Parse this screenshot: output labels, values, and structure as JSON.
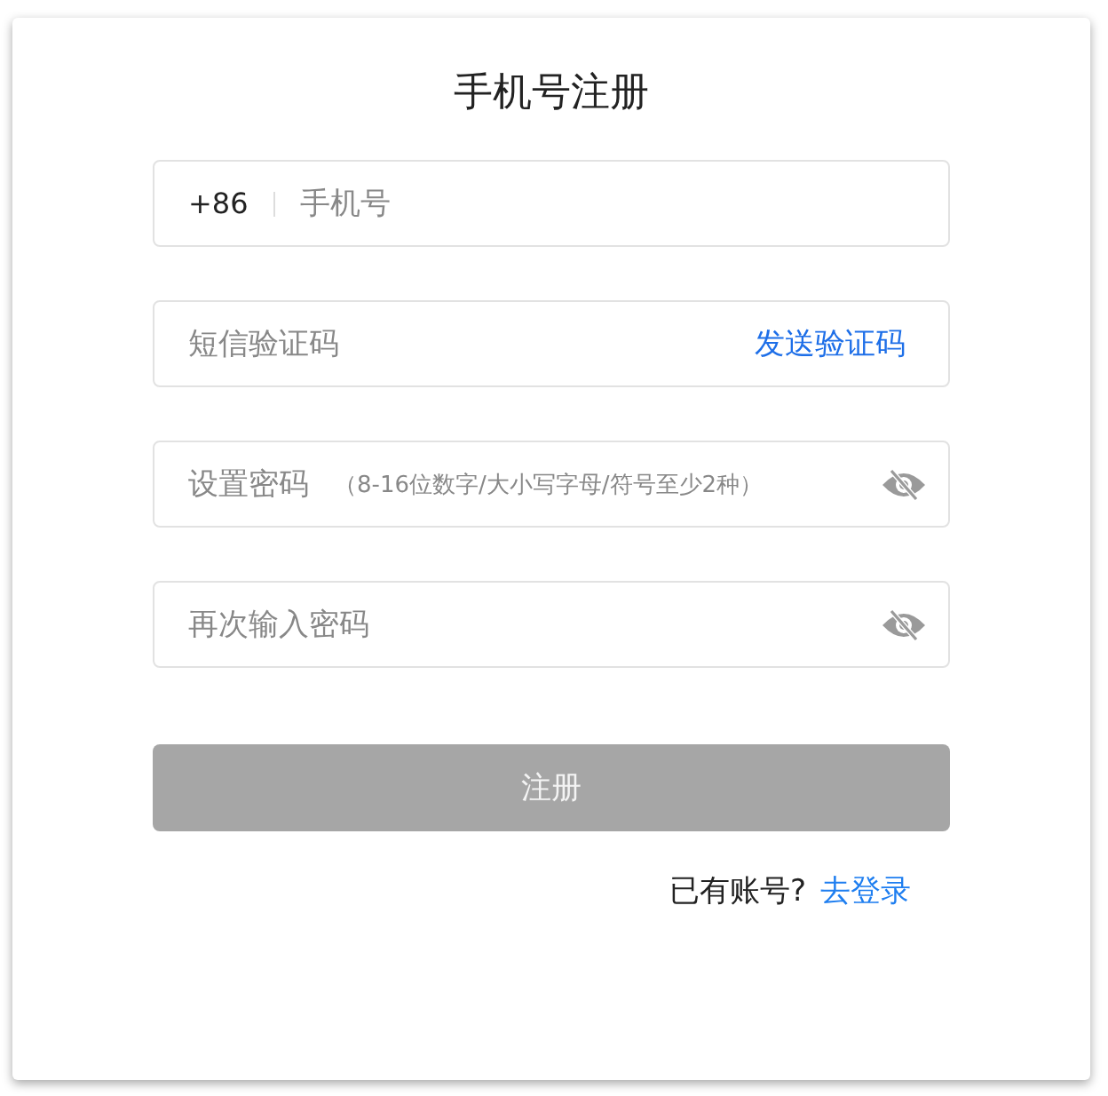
{
  "title": "手机号注册",
  "fields": [
    {
      "kind": "phone",
      "prefix": "+86",
      "placeholder": "手机号"
    },
    {
      "kind": "code",
      "placeholder": "短信验证码",
      "action": "发送验证码"
    },
    {
      "kind": "password",
      "placeholder": "设置密码",
      "hint": "（8-16位数字/大小写字母/符号至少2种）"
    },
    {
      "kind": "password",
      "placeholder": "再次输入密码"
    }
  ],
  "submit": {
    "label": "注册",
    "disabled": true
  },
  "footer": {
    "text": "已有账号?",
    "link": "去登录"
  }
}
